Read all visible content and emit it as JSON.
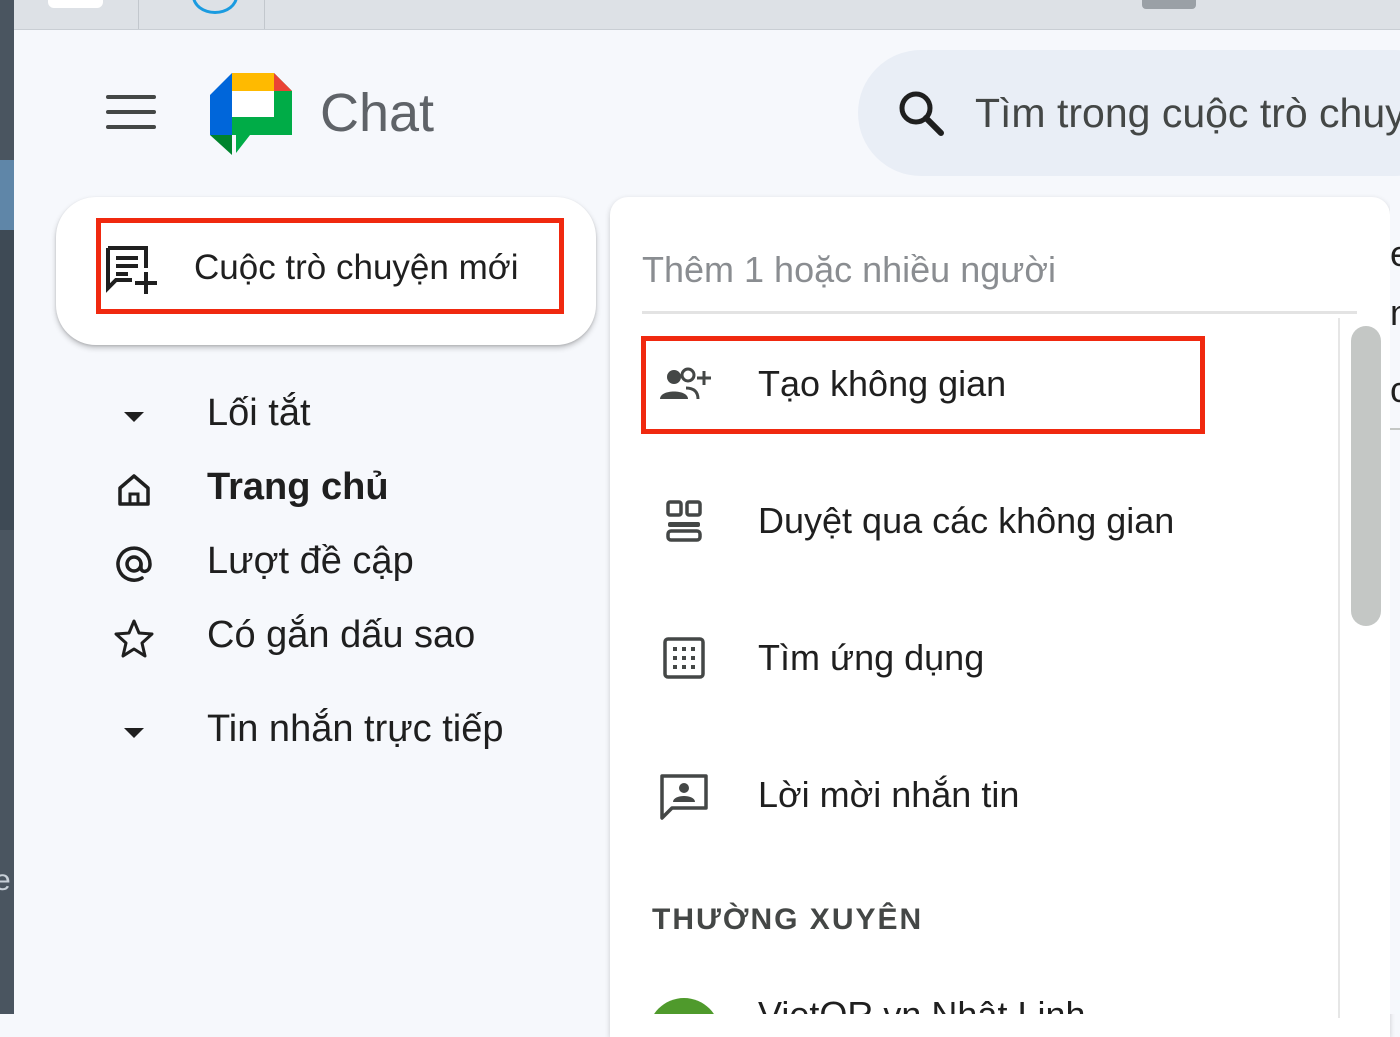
{
  "app": {
    "title": "Chat"
  },
  "search": {
    "placeholder": "Tìm trong cuộc trò chuyện"
  },
  "sidebar": {
    "new_chat_label": "Cuộc trò chuyện mới",
    "sections": [
      {
        "label": "Lối tắt"
      },
      {
        "label": "Tin nhắn trực tiếp"
      }
    ],
    "items": [
      {
        "label": "Trang chủ",
        "icon": "home-icon"
      },
      {
        "label": "Lượt đề cập",
        "icon": "at-icon"
      },
      {
        "label": "Có gắn dấu sao",
        "icon": "star-icon"
      }
    ]
  },
  "dropdown": {
    "input_placeholder": "Thêm 1 hoặc nhiều người",
    "items": [
      {
        "label": "Tạo không gian",
        "icon": "add-group-icon"
      },
      {
        "label": "Duyệt qua các không gian",
        "icon": "browse-spaces-icon"
      },
      {
        "label": "Tìm ứng dụng",
        "icon": "apps-grid-icon"
      },
      {
        "label": "Lời mời nhắn tin",
        "icon": "message-request-icon"
      }
    ],
    "frequent_title": "THƯỜNG XUYÊN",
    "frequent": [
      {
        "name": "VietQR.vn Nhật Linh"
      }
    ]
  },
  "colors": {
    "highlight": "#f0290f",
    "background": "#f6f8fc",
    "search_bg": "#e9eef6",
    "avatar": "#4f9a2c"
  }
}
